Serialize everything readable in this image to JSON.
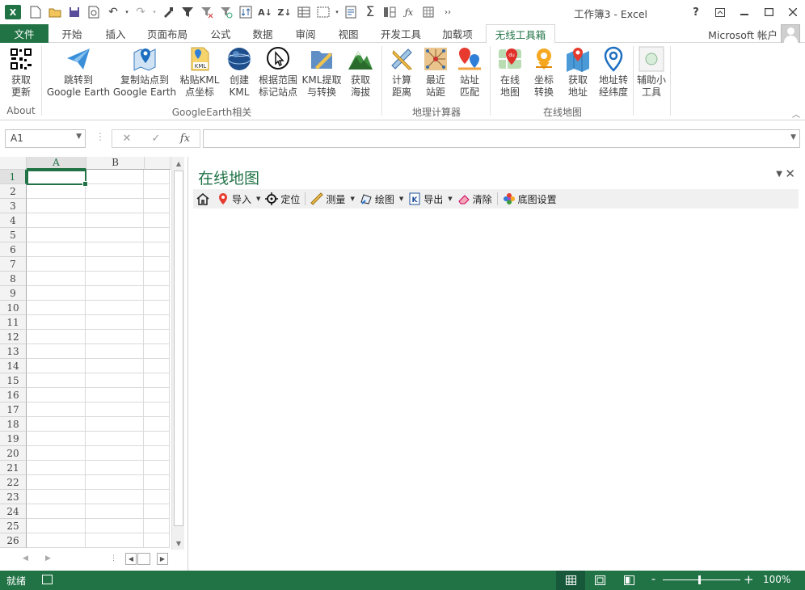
{
  "window": {
    "title": "工作簿3 - Excel",
    "help": "?",
    "account": "Microsoft 帐户"
  },
  "tabs": [
    {
      "label": "文件"
    },
    {
      "label": "开始"
    },
    {
      "label": "插入"
    },
    {
      "label": "页面布局"
    },
    {
      "label": "公式"
    },
    {
      "label": "数据"
    },
    {
      "label": "审阅"
    },
    {
      "label": "视图"
    },
    {
      "label": "开发工具"
    },
    {
      "label": "加载项"
    },
    {
      "label": "无线工具箱"
    }
  ],
  "ribbon": {
    "buttons": [
      {
        "label1": "获取",
        "label2": "更新",
        "icon": "qr-code-icon"
      },
      {
        "label1": "跳转到",
        "label2": "Google Earth",
        "icon": "paper-plane-icon"
      },
      {
        "label1": "复制站点到",
        "label2": "Google Earth",
        "icon": "map-pin-icon"
      },
      {
        "label1": "粘贴KML",
        "label2": "点坐标",
        "icon": "kml-file-icon"
      },
      {
        "label1": "创建",
        "label2": "KML",
        "icon": "globe-icon"
      },
      {
        "label1": "根据范围",
        "label2": "标记站点",
        "icon": "pointer-circle-icon"
      },
      {
        "label1": "KML提取",
        "label2": "与转换",
        "icon": "folder-ruler-icon"
      },
      {
        "label1": "获取",
        "label2": "海拔",
        "icon": "mountain-icon"
      },
      {
        "label1": "计算",
        "label2": "距离",
        "icon": "ruler-pencil-icon"
      },
      {
        "label1": "最近",
        "label2": "站距",
        "icon": "network-icon"
      },
      {
        "label1": "站址",
        "label2": "匹配",
        "icon": "location-match-icon"
      },
      {
        "label1": "在线",
        "label2": "地图",
        "icon": "baidu-map-icon"
      },
      {
        "label1": "坐标",
        "label2": "转换",
        "icon": "coordinate-icon"
      },
      {
        "label1": "获取",
        "label2": "地址",
        "icon": "map-address-icon"
      },
      {
        "label1": "地址转",
        "label2": "经纬度",
        "icon": "location-pin-icon"
      },
      {
        "label1": "辅助小",
        "label2": "工具",
        "icon": "tool-circle-icon"
      }
    ],
    "groups": [
      {
        "label": "About"
      },
      {
        "label": "GoogleEarth相关"
      },
      {
        "label": "地理计算器"
      },
      {
        "label": "在线地图"
      }
    ]
  },
  "formula": {
    "namebox": "A1",
    "fx": "fx",
    "cancel": "✕",
    "enter": "✓",
    "value": ""
  },
  "sheet": {
    "columns": [
      "A",
      "B"
    ],
    "rows": [
      "1",
      "2",
      "3",
      "4",
      "5",
      "6",
      "7",
      "8",
      "9",
      "10",
      "11",
      "12",
      "13",
      "14",
      "15",
      "16",
      "17",
      "18",
      "19",
      "20",
      "21",
      "22",
      "23",
      "24",
      "25",
      "26"
    ],
    "active_cell": "A1"
  },
  "pane": {
    "title": "在线地图",
    "toolbar": [
      {
        "label": "导入",
        "icon": "red-pin-icon",
        "dropdown": true
      },
      {
        "label": "定位",
        "icon": "crosshair-icon",
        "dropdown": false
      },
      {
        "label": "测量",
        "icon": "ruler-icon",
        "dropdown": true
      },
      {
        "label": "绘图",
        "icon": "draw-polygon-icon",
        "dropdown": true
      },
      {
        "label": "导出",
        "icon": "export-icon",
        "dropdown": true
      },
      {
        "label": "清除",
        "icon": "eraser-icon",
        "dropdown": false
      },
      {
        "label": "底图设置",
        "icon": "palette-icon",
        "dropdown": false
      }
    ]
  },
  "status": {
    "ready": "就绪",
    "zoom": "100%",
    "zoom_level": 1.0
  },
  "colors": {
    "accent": "#217346",
    "status_bg": "#217346"
  }
}
